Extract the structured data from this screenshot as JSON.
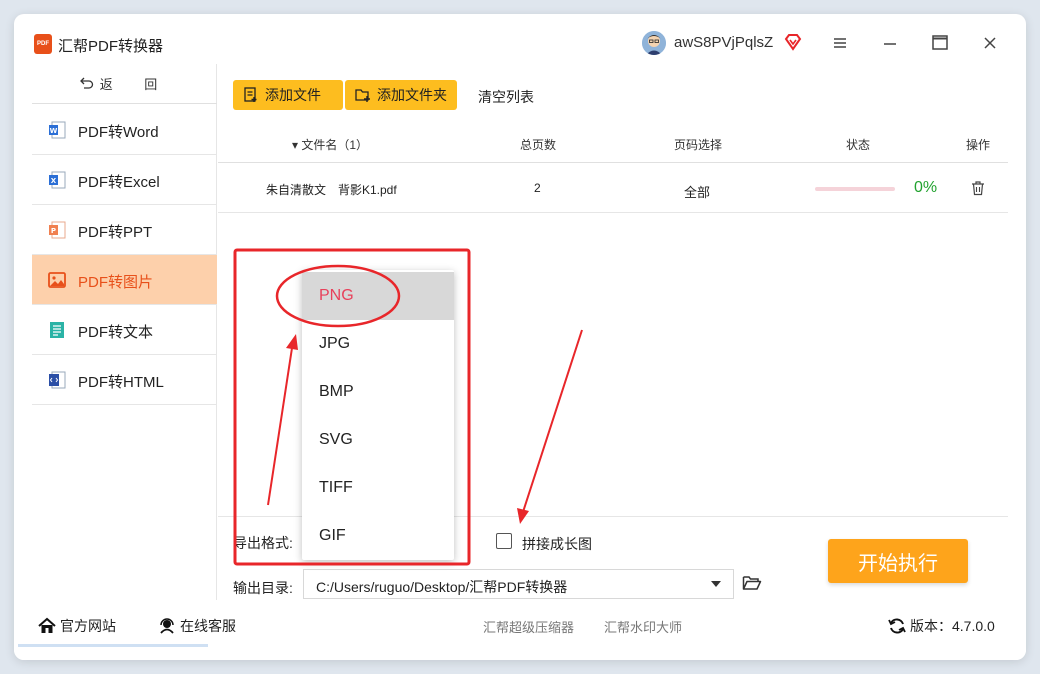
{
  "app": {
    "title": "汇帮PDF转换器",
    "logo_text": "PDF"
  },
  "user": {
    "name": "awS8PVjPqlsZ"
  },
  "sidebar": {
    "back_label": "返 回",
    "items": [
      {
        "label": "PDF转Word",
        "icon": "word-icon",
        "color": "#2b6fd6"
      },
      {
        "label": "PDF转Excel",
        "icon": "excel-icon",
        "color": "#1f9d55"
      },
      {
        "label": "PDF转PPT",
        "icon": "ppt-icon",
        "color": "#e8501a"
      },
      {
        "label": "PDF转图片",
        "icon": "image-icon",
        "color": "#e8501a",
        "active": true
      },
      {
        "label": "PDF转文本",
        "icon": "text-icon",
        "color": "#2bb3a6"
      },
      {
        "label": "PDF转HTML",
        "icon": "html-icon",
        "color": "#2b4fa6"
      }
    ]
  },
  "toolbar": {
    "add_file": "添加文件",
    "add_folder": "添加文件夹",
    "clear_list": "清空列表"
  },
  "table": {
    "headers": {
      "filename": "▾ 文件名（1）",
      "pages": "总页数",
      "page_select": "页码选择",
      "status": "状态",
      "action": "操作"
    },
    "rows": [
      {
        "name": "朱自清散文　背影K1.pdf",
        "pages": "2",
        "page_select": "全部",
        "progress_text": "0%",
        "progress": 0
      }
    ]
  },
  "format": {
    "label": "导出格式:",
    "options": [
      "PNG",
      "JPG",
      "BMP",
      "SVG",
      "TIFF",
      "GIF"
    ],
    "selected": "PNG"
  },
  "stitch": {
    "label": "拼接成长图",
    "checked": false
  },
  "output": {
    "label": "输出目录:",
    "path": "C:/Users/ruguo/Desktop/汇帮PDF转换器"
  },
  "start_button": "开始执行",
  "footer": {
    "website": "官方网站",
    "support": "在线客服",
    "link1": "汇帮超级压缩器",
    "link2": "汇帮水印大师",
    "version": "版本：4.7.0.0"
  },
  "colors": {
    "accent": "#e8501a",
    "button_yellow": "#fdbd1f",
    "start_orange": "#fea41b",
    "annotation_red": "#e8262a",
    "success_green": "#22a22f"
  }
}
